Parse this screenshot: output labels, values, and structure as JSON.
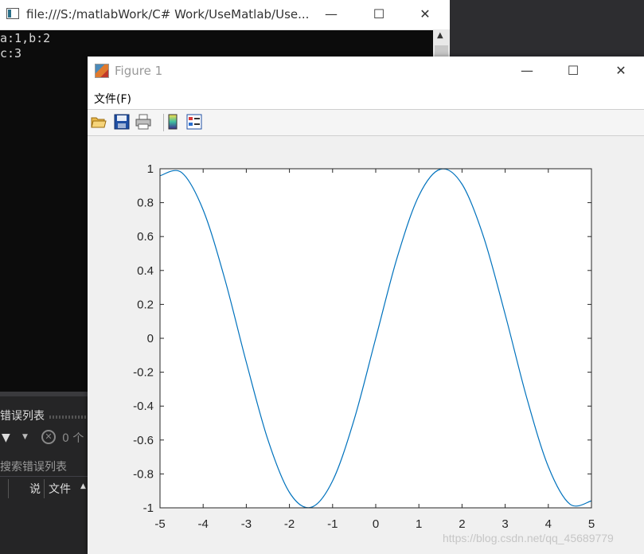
{
  "console": {
    "title": "file:///S:/matlabWork/C# Work/UseMatlab/Use...",
    "lines": [
      "a:1,b:2",
      "c:3"
    ],
    "minimize": "—",
    "maximize": "☐",
    "close": "✕"
  },
  "ide": {
    "panel_title": "错误列表",
    "error_count": "0 个",
    "search_placeholder": "搜索错误列表",
    "col_desc": "说",
    "col_file": "文件"
  },
  "figure": {
    "title": "Figure 1",
    "menu_file": "文件(F)",
    "minimize": "—",
    "maximize": "☐",
    "close": "✕",
    "toolbar": [
      {
        "name": "open-file-icon"
      },
      {
        "name": "save-icon"
      },
      {
        "name": "print-icon"
      },
      {
        "name": "colorbar-icon"
      },
      {
        "name": "legend-icon"
      }
    ]
  },
  "chart_data": {
    "type": "line",
    "function": "sin(x)",
    "xlim": [
      -5,
      5
    ],
    "ylim": [
      -1,
      1
    ],
    "xticks": [
      -5,
      -4,
      -3,
      -2,
      -1,
      0,
      1,
      2,
      3,
      4,
      5
    ],
    "yticks": [
      1,
      0.8,
      0.6,
      0.4,
      0.2,
      0,
      -0.2,
      -0.4,
      -0.6,
      -0.8,
      -1
    ],
    "grid": false,
    "series": [
      {
        "color": "#0072BD",
        "x": [
          -5,
          -4.5,
          -4,
          -3.5,
          -3,
          -2.5,
          -2,
          -1.5,
          -1,
          -0.5,
          0,
          0.5,
          1,
          1.5,
          2,
          2.5,
          3,
          3.5,
          4,
          4.5,
          5
        ],
        "y": [
          0.959,
          0.978,
          0.757,
          0.351,
          -0.141,
          -0.598,
          -0.909,
          -0.997,
          -0.841,
          -0.479,
          0,
          0.479,
          0.841,
          0.997,
          0.909,
          0.598,
          0.141,
          -0.351,
          -0.757,
          -0.978,
          -0.959
        ]
      }
    ]
  },
  "watermark": "https://blog.csdn.net/qq_45689779"
}
